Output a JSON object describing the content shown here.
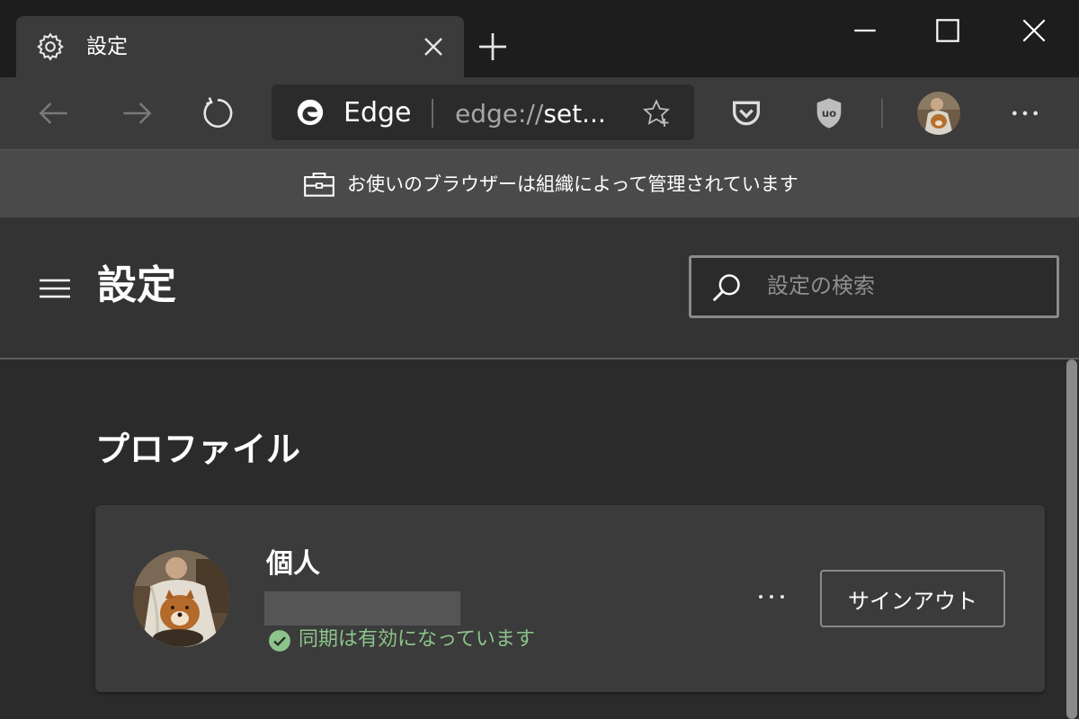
{
  "tab": {
    "title": "設定",
    "icon": "gear-icon",
    "close_icon": "close-icon"
  },
  "window_controls": {
    "minimize_icon": "minimize-icon",
    "maximize_icon": "maximize-icon",
    "close_icon": "close-icon"
  },
  "toolbar": {
    "back_icon": "back-arrow-icon",
    "forward_icon": "forward-arrow-icon",
    "refresh_icon": "refresh-icon",
    "omnibox": {
      "site_name": "Edge",
      "url_prefix": "edge://",
      "url_rest": "set...",
      "favorite_icon": "star-add-icon"
    },
    "extensions": [
      "pocket-icon",
      "ublock-origin-icon"
    ],
    "more_icon": "more-horizontal-icon"
  },
  "infobar": {
    "text": "お使いのブラウザーは組織によって管理されています",
    "icon": "briefcase-icon"
  },
  "header": {
    "title": "設定",
    "search_placeholder": "設定の検索"
  },
  "profile": {
    "section_title": "プロファイル",
    "name": "個人",
    "sync_status": "同期は有効になっています",
    "signout_label": "サインアウト"
  },
  "colors": {
    "titlebar": "#1d1d1d",
    "toolbar": "#3b3b3b",
    "infobar": "#4a4a4a",
    "header": "#333333",
    "content": "#2b2b2b",
    "card": "#3b3b3b",
    "sync_green": "#8cc48c"
  }
}
